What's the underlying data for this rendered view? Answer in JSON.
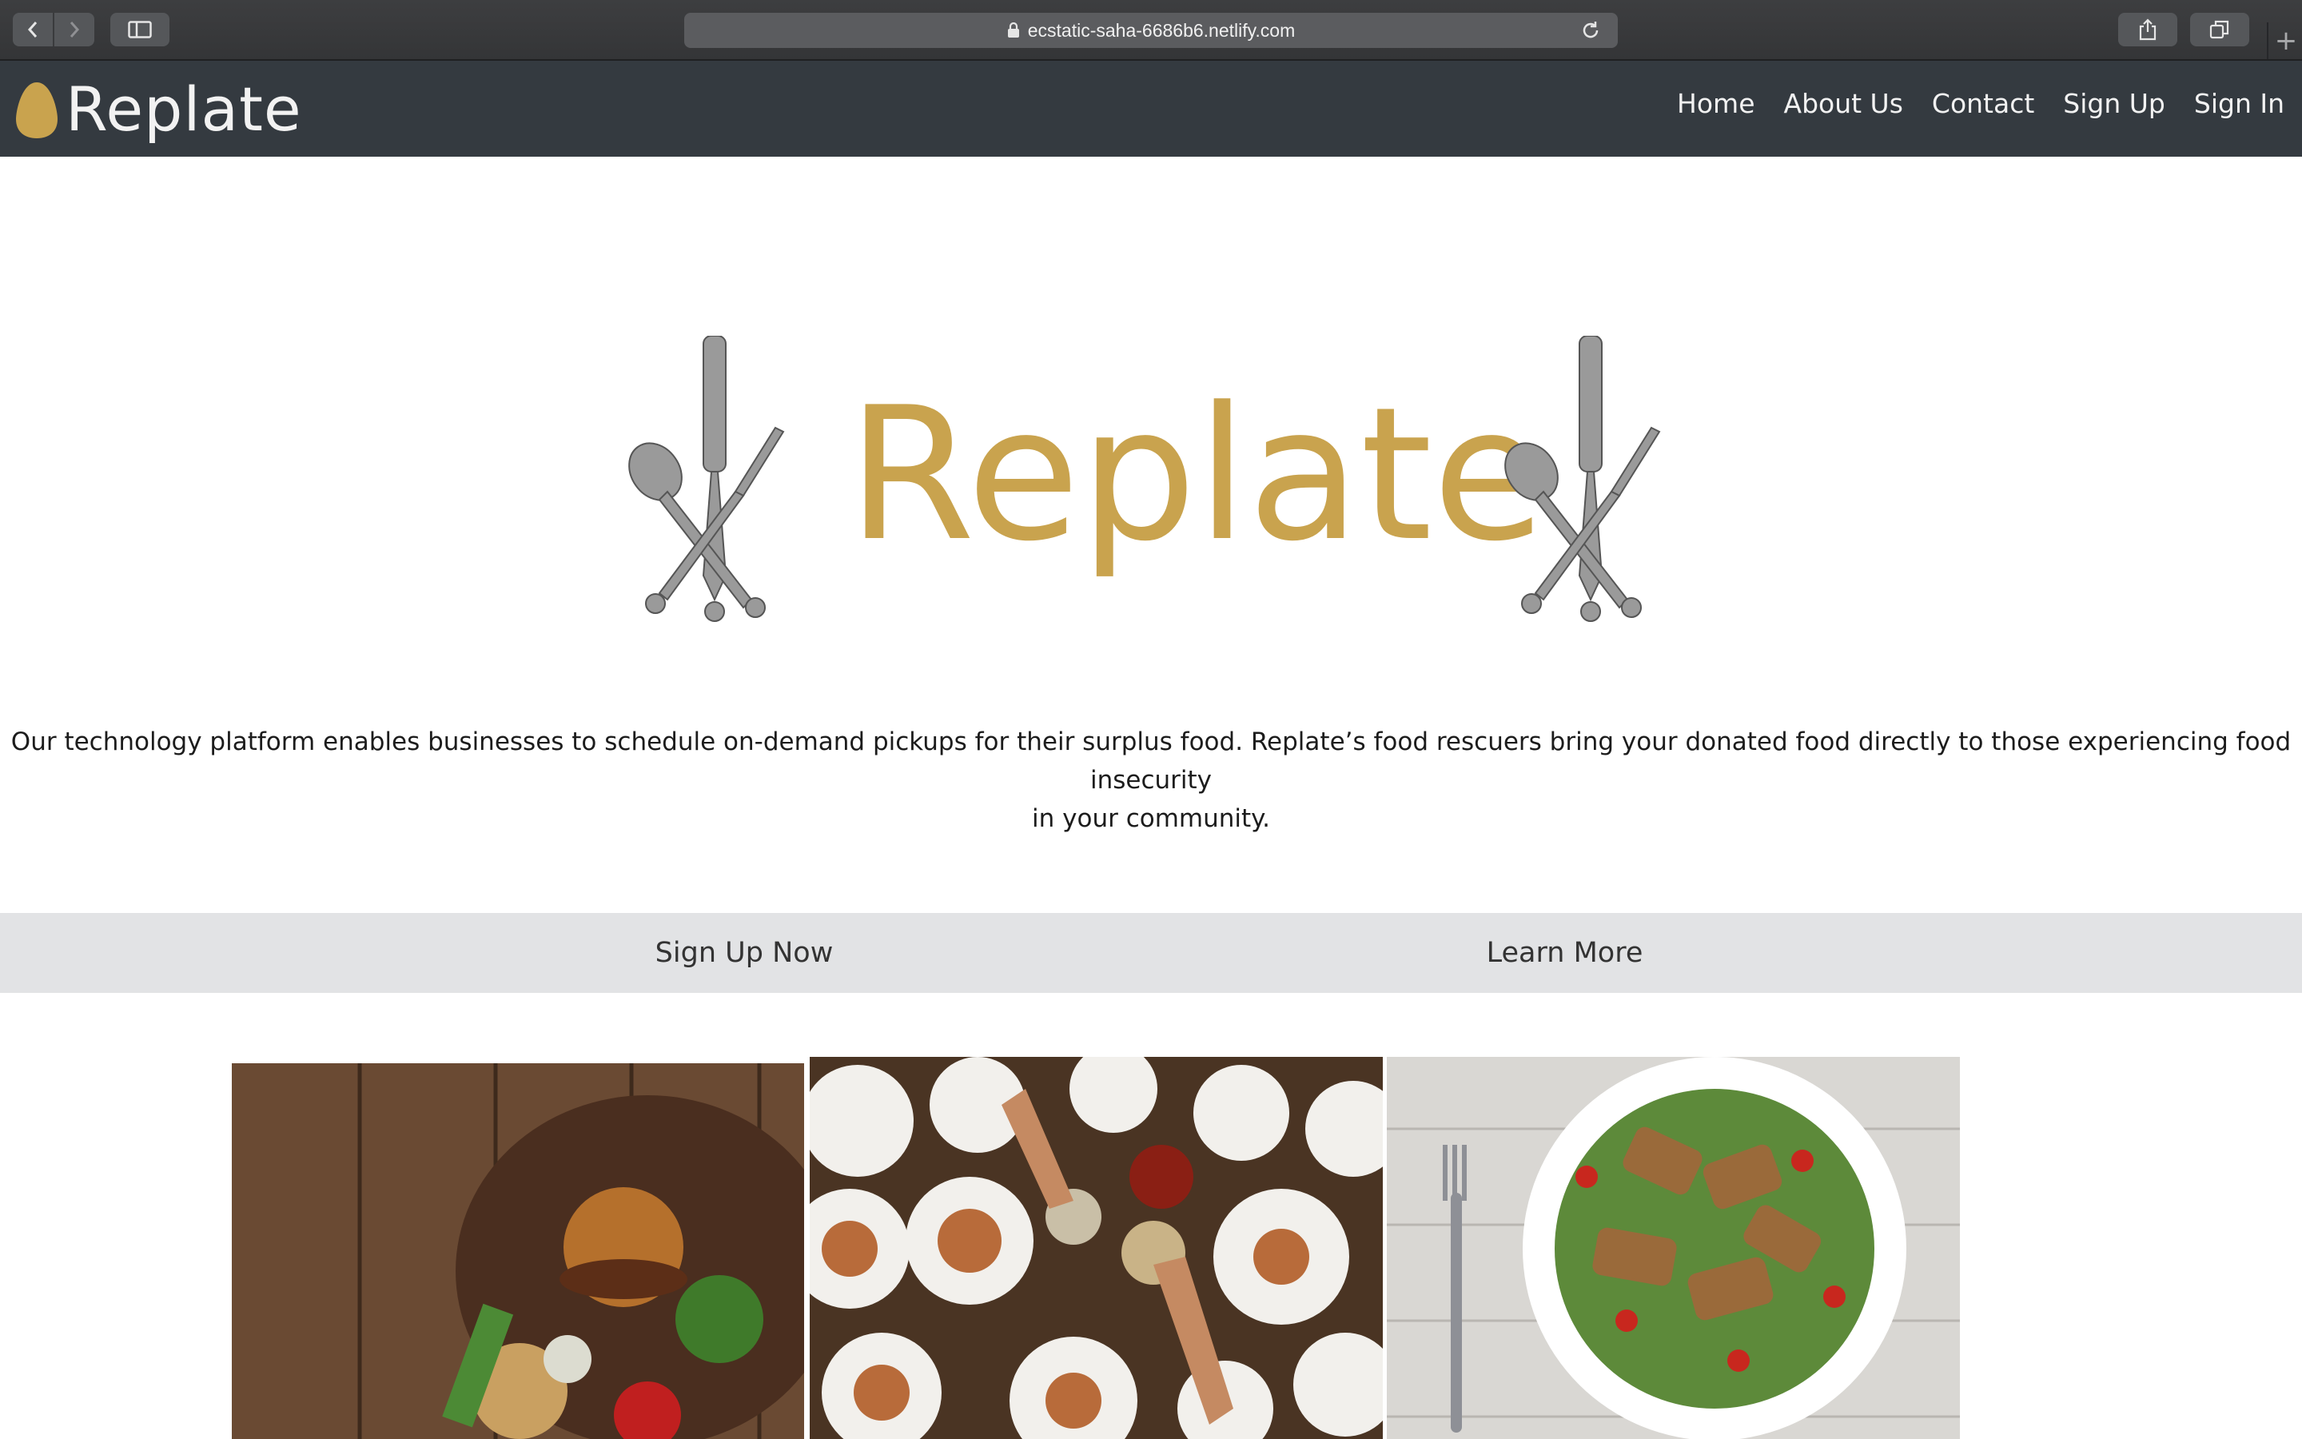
{
  "browser": {
    "url": "ecstatic-saha-6686b6.netlify.com"
  },
  "nav": {
    "brand": "Replate",
    "links": [
      "Home",
      "About Us",
      "Contact",
      "Sign Up",
      "Sign In"
    ]
  },
  "hero": {
    "title": "Replate",
    "tagline_line1": "Our technology platform enables businesses to schedule on-demand pickups for their surplus food. Replate’s food rescuers bring your donated food directly to those experiencing food insecurity",
    "tagline_line2": "in your community."
  },
  "actions": {
    "signup_label": "Sign Up Now",
    "learn_label": "Learn More"
  },
  "colors": {
    "brand_gold": "#c9a34e",
    "nav_bg": "#343a40",
    "action_bar_bg": "#e2e3e5"
  },
  "icons": [
    "back-icon",
    "forward-icon",
    "sidebar-icon",
    "lock-icon",
    "reload-icon",
    "share-icon",
    "tabs-icon",
    "new-tab-icon",
    "egg-logo-icon",
    "cutlery-icon"
  ]
}
